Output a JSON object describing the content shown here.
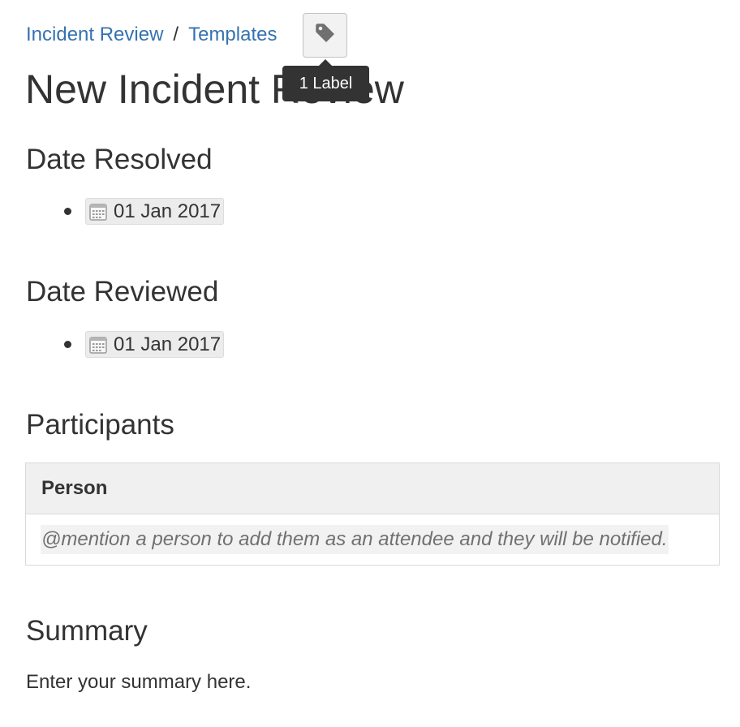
{
  "breadcrumb": {
    "items": [
      {
        "label": "Incident Review"
      },
      {
        "label": "Templates"
      }
    ],
    "separator": "/"
  },
  "labels": {
    "icon": "tag-icon",
    "tooltip": "1 Label"
  },
  "page": {
    "title": "New Incident Review"
  },
  "sections": {
    "date_resolved": {
      "heading": "Date Resolved",
      "date": "01 Jan 2017",
      "icon": "calendar-icon"
    },
    "date_reviewed": {
      "heading": "Date Reviewed",
      "date": "01 Jan 2017",
      "icon": "calendar-icon"
    },
    "participants": {
      "heading": "Participants",
      "table": {
        "columns": [
          "Person"
        ],
        "rows": [
          [
            "@mention a person to add them as an attendee and they will be notified."
          ]
        ]
      }
    },
    "summary": {
      "heading": "Summary",
      "text": "Enter your summary here."
    }
  },
  "colors": {
    "link": "#3572b0",
    "text": "#333333",
    "tooltip_bg": "#333333",
    "placeholder": "#707070"
  }
}
